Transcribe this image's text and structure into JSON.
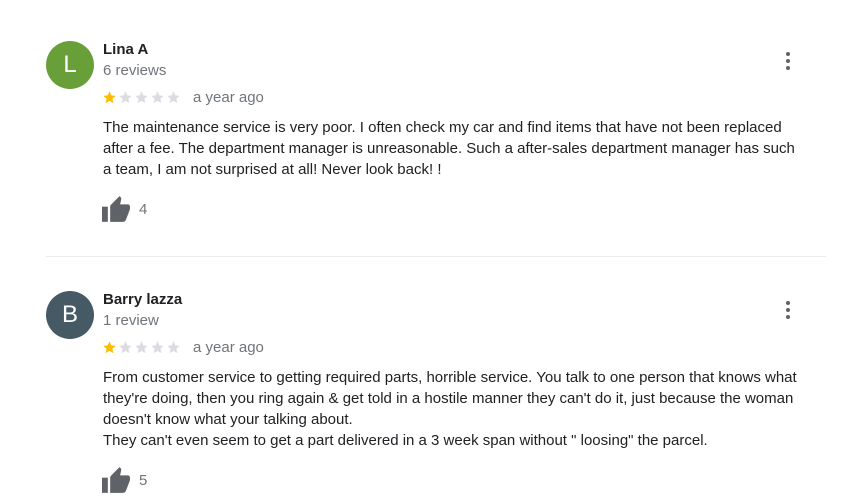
{
  "reviews": [
    {
      "initial": "L",
      "avatar_color": "#689f38",
      "name": "Lina A",
      "review_count": "6 reviews",
      "rating": 1,
      "max_rating": 5,
      "date": "a year ago",
      "text": "The maintenance service is very poor. I often check my car and find items that have not been replaced\nafter a fee. The department manager is unreasonable. Such a after-sales department manager has such\na team, I am not surprised at all!  Never look back!  !",
      "likes": "4",
      "menu_icon": "more-vert-icon",
      "like_icon": "thumb-up-icon"
    },
    {
      "initial": "B",
      "avatar_color": "#455a64",
      "name": "Barry lazza",
      "review_count": "1 review",
      "rating": 1,
      "max_rating": 5,
      "date": "a year ago",
      "text": "From customer service to getting required parts, horrible service. You talk to one person that knows what\nthey're doing, then you ring again & get told in a hostile manner they can't do it, just because the woman\ndoesn't know what your talking about.\nThey can't even seem to get a part delivered in a 3 week span without \" loosing\" the parcel.",
      "likes": "5",
      "menu_icon": "more-vert-icon",
      "like_icon": "thumb-up-icon"
    }
  ],
  "colors": {
    "star_filled": "#fbbc04",
    "star_empty": "#dadce0",
    "secondary_text": "#70757a",
    "icon": "#5f6368"
  }
}
